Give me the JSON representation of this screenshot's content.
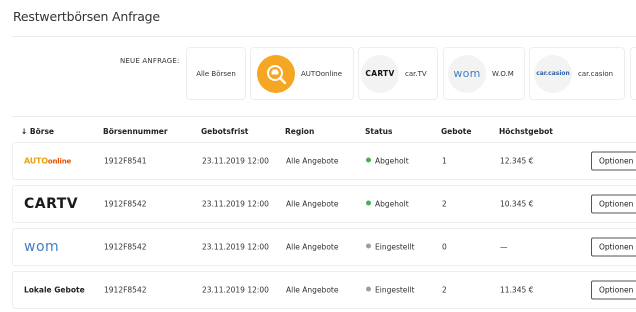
{
  "page": {
    "title": "Restwertbörsen Anfrage"
  },
  "anfrage": {
    "label": "NEUE ANFRAGE:",
    "cards": [
      {
        "id": "all",
        "label": "Alle Börsen",
        "active": false
      },
      {
        "id": "autoonline",
        "label": "AUTOonline",
        "active": true,
        "icon": "search-car-icon"
      },
      {
        "id": "cartv",
        "label": "car.TV",
        "logo": "CARTV",
        "active": false
      },
      {
        "id": "wom",
        "label": "W.O.M",
        "logo": "wom",
        "active": false
      },
      {
        "id": "carcasion",
        "label": "car.casion",
        "logo": "car.casion",
        "active": false
      }
    ]
  },
  "table": {
    "headers": {
      "boerse": "↓ Börse",
      "nummer": "Börsennummer",
      "gebotsfrist": "Gebotsfrist",
      "region": "Region",
      "status": "Status",
      "gebote": "Gebote",
      "hoechstgebot": "Höchstgebot"
    },
    "rows": [
      {
        "logo": {
          "main": "AUTO",
          "sub": "online"
        },
        "nummer": "1912F8541",
        "gebotsfrist": "23.11.2019 12:00",
        "region": "Alle Angebote",
        "status": "Abgeholt",
        "status_color": "#4caf50",
        "gebote": "1",
        "hoechstgebot": "12.345 €",
        "button": "Optionen"
      },
      {
        "logo": "CARTV",
        "nummer": "1912F8542",
        "gebotsfrist": "23.11.2019 12:00",
        "region": "Alle Angebote",
        "status": "Abgeholt",
        "status_color": "#4caf50",
        "gebote": "2",
        "hoechstgebot": "10.345 €",
        "button": "Optionen"
      },
      {
        "logo": "wom",
        "nummer": "1912F8542",
        "gebotsfrist": "23.11.2019 12:00",
        "region": "Alle Angebote",
        "status": "Eingestellt",
        "status_color": "#9e9e9e",
        "gebote": "0",
        "hoechstgebot": "—",
        "button": "Optionen"
      },
      {
        "logo": "Lokale Gebote",
        "nummer": "1912F8542",
        "gebotsfrist": "23.11.2019 12:00",
        "region": "Alle Angebote",
        "status": "Eingestellt",
        "status_color": "#9e9e9e",
        "gebote": "2",
        "hoechstgebot": "11.345 €",
        "button": "Optionen"
      }
    ]
  },
  "colors": {
    "accent": "#f5a623",
    "green": "#4caf50",
    "grey": "#9e9e9e",
    "wom_blue": "#3f7fc8"
  }
}
